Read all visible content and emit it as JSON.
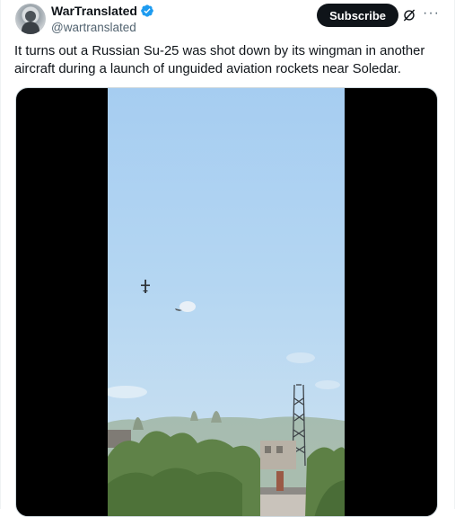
{
  "tweet": {
    "display_name": "WarTranslated",
    "handle": "@wartranslated",
    "verified": true,
    "subscribe_label": "Subscribe",
    "more_label": "···",
    "text": "It turns out a Russian Su-25 was shot down by its wingman in another aircraft during a launch of unguided aviation rockets near Soledar.",
    "icons": [
      "avatar",
      "verified-badge-icon",
      "grok-icon",
      "more-icon"
    ]
  },
  "media": {
    "type": "video",
    "scene": "sky"
  },
  "colors": {
    "accent": "#1d9bf0",
    "button_bg": "#0f1419",
    "text_primary": "#0f1419",
    "text_secondary": "#536471"
  }
}
